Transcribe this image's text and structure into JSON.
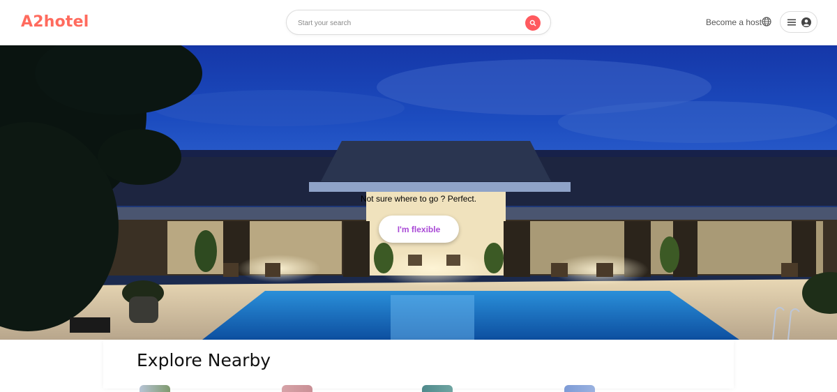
{
  "header": {
    "logo": "A2hotel",
    "search": {
      "placeholder": "Start your search"
    },
    "become_host": "Become a host"
  },
  "hero": {
    "tagline": "Not sure where to go ? Perfect.",
    "flexible_button": "I'm flexible"
  },
  "explore": {
    "title": "Explore Nearby"
  },
  "colors": {
    "brand": "#ff6b5e",
    "search_button": "#ff5a5f",
    "flexible_text": "#a94ad6"
  },
  "icons": [
    "search-icon",
    "globe-icon",
    "menu-icon",
    "account-icon"
  ]
}
